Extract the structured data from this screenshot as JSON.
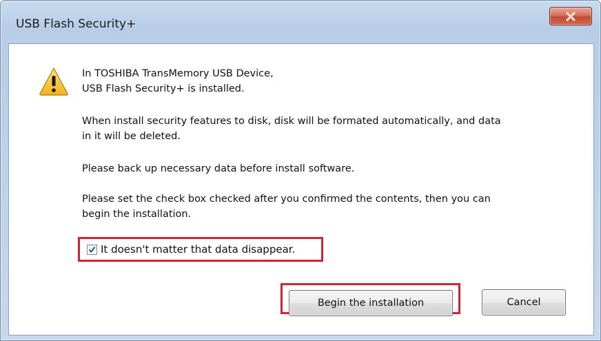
{
  "window": {
    "title": "USB Flash Security+"
  },
  "message": {
    "line1": "In TOSHIBA TransMemory USB Device,\n USB Flash Security+ is installed.",
    "line2": "When install security features to disk, disk will be formated automatically, and data\nin it will be deleted.",
    "line3": "Please back up necessary data before install software.",
    "line4": "Please set the check box checked after you confirmed the contents, then you can\nbegin the installation."
  },
  "confirm_checkbox": {
    "label": "It doesn't matter that data disappear.",
    "checked": true
  },
  "buttons": {
    "begin_label": "Begin the installation",
    "cancel_label": "Cancel"
  },
  "icons": {
    "warning": "warning-icon",
    "close": "close-icon",
    "check": "checkmark-icon"
  },
  "colors": {
    "highlight": "#d9222f",
    "close_button": "#c84a33",
    "frame": "#bcd1e8"
  }
}
